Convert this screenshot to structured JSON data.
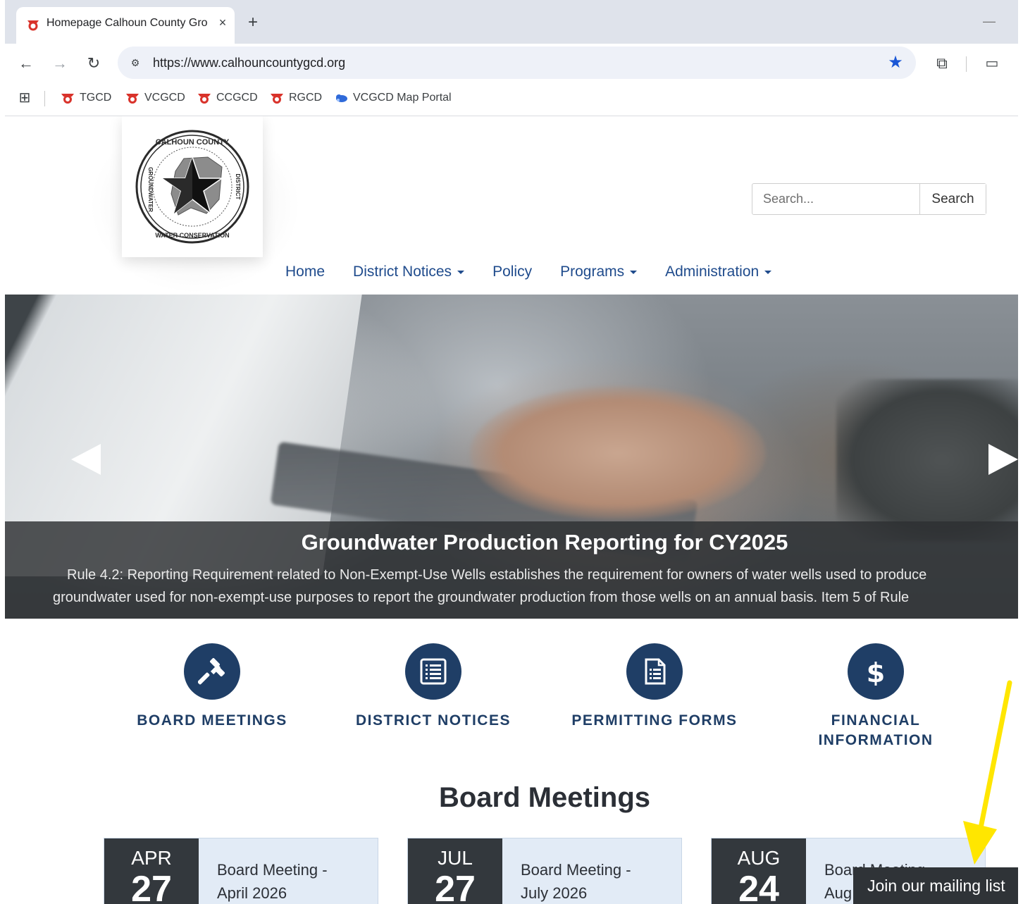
{
  "browser": {
    "tab_title": "Homepage Calhoun County Gro",
    "tab_close": "×",
    "new_tab": "+",
    "url": "https://www.calhouncountygcd.org",
    "bookmarks": [
      "TGCD",
      "VCGCD",
      "CCGCD",
      "RGCD",
      "VCGCD Map Portal"
    ]
  },
  "header": {
    "logo_alt": "Calhoun County Groundwater Conservation District",
    "search_placeholder": "Search...",
    "search_button": "Search"
  },
  "nav": {
    "items": [
      {
        "label": "Home",
        "dropdown": false
      },
      {
        "label": "District Notices",
        "dropdown": true
      },
      {
        "label": "Policy",
        "dropdown": false
      },
      {
        "label": "Programs",
        "dropdown": true
      },
      {
        "label": "Administration",
        "dropdown": true
      }
    ]
  },
  "hero": {
    "title": "Groundwater Production Reporting for CY2025",
    "line1": "Rule 4.2: Reporting Requirement related to Non-Exempt-Use Wells establishes the requirement for owners of water wells used to produce",
    "line2": "groundwater used for non-exempt-use purposes to report the groundwater production from those wells on an annual basis.  Item 5 of Rule"
  },
  "quicklinks": [
    {
      "label": "BOARD MEETINGS",
      "icon": "gavel-icon"
    },
    {
      "label": "DISTRICT NOTICES",
      "icon": "list-icon"
    },
    {
      "label": "PERMITTING FORMS",
      "icon": "document-icon"
    },
    {
      "label": "FINANCIAL INFORMATION",
      "icon": "dollar-icon"
    }
  ],
  "board_meetings": {
    "title": "Board Meetings",
    "items": [
      {
        "month": "APR",
        "day": "27",
        "title": "Board Meeting - April 2026"
      },
      {
        "month": "JUL",
        "day": "27",
        "title": "Board Meeting - July 2026"
      },
      {
        "month": "AUG",
        "day": "24",
        "title": "Board Meeting - Aug"
      }
    ]
  },
  "mailing_list": "Join our mailing list",
  "colors": {
    "brand_navy": "#1f3e66",
    "nav_blue": "#1f4b8c",
    "annotation_yellow": "#ffe600"
  }
}
